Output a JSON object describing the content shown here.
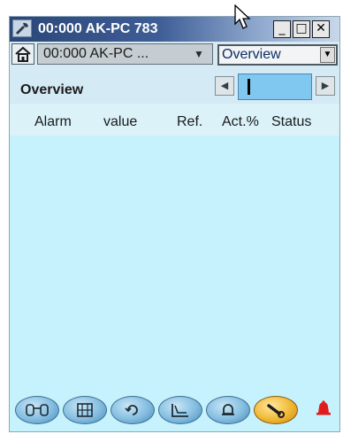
{
  "window": {
    "title": "00:000 AK-PC 783",
    "minimize_glyph": "_",
    "maximize_glyph": "□",
    "close_glyph": "✕"
  },
  "toolbar": {
    "home_icon": "home-icon",
    "device_select": {
      "value": "00:000 AK-PC ...",
      "arrow": "▼"
    },
    "view_select": {
      "value": "Overview",
      "arrow": "▼"
    }
  },
  "section": {
    "title": "Overview",
    "pager": {
      "prev": "◀",
      "next": "▶"
    }
  },
  "columns": [
    "Alarm",
    "value",
    "Ref.",
    "Act.%",
    "Status"
  ],
  "bottom_nav": [
    {
      "icon": "binoculars-icon",
      "glyph": "⌕"
    },
    {
      "icon": "grid-icon",
      "glyph": "▦"
    },
    {
      "icon": "refresh-icon",
      "glyph": "↺"
    },
    {
      "icon": "chart-icon",
      "glyph": "⊾"
    },
    {
      "icon": "bell-outline-icon",
      "glyph": "⍾"
    },
    {
      "icon": "wrench-icon",
      "glyph": "⚒"
    }
  ],
  "alarm_indicator": {
    "icon": "alarm-bell-icon",
    "glyph": "▲",
    "color": "#e21b1b"
  },
  "colors": {
    "title_bar": "#2b4778",
    "content_bg": "#c6f2fd",
    "active_tool": "#f0b832"
  }
}
